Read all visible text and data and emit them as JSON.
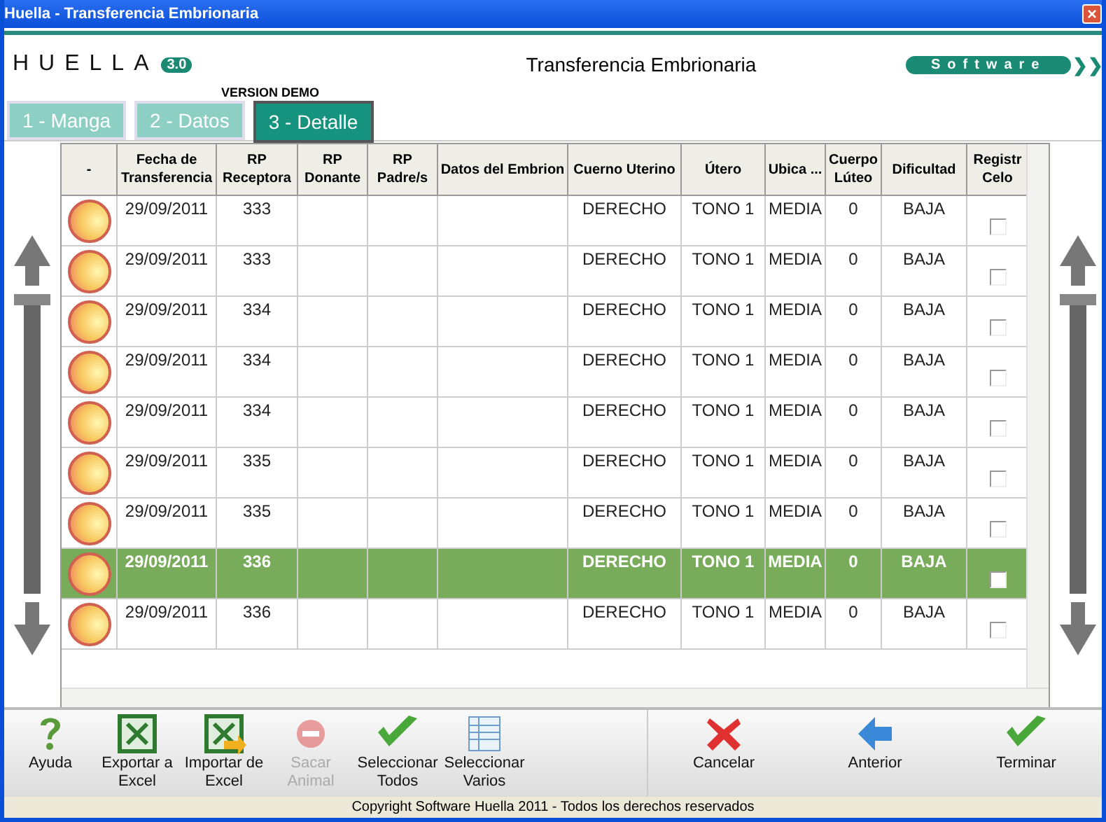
{
  "window": {
    "title": "Huella - Transferencia Embrionaria",
    "close": "×"
  },
  "header": {
    "logo": "HUELLA",
    "logo_version": "3.0",
    "title": "Transferencia Embrionaria",
    "badge": "Software",
    "badge_arrows": "❯❯"
  },
  "version_note": "VERSION DEMO",
  "tabs": [
    {
      "label": "1 - Manga",
      "selected": false
    },
    {
      "label": "2 - Datos",
      "selected": false
    },
    {
      "label": "3 - Detalle",
      "selected": true
    }
  ],
  "table": {
    "columns": [
      "-",
      "Fecha de Transferencia",
      "RP Receptora",
      "RP Donante",
      "RP Padre/s",
      "Datos del Embrion",
      "Cuerno Uterino",
      "Útero",
      "Ubica ...",
      "Cuerpo Lúteo",
      "Dificultad",
      "Registr Celo"
    ],
    "rows": [
      {
        "fecha": "29/09/2011",
        "rp_receptora": "333",
        "cuerno": "DERECHO",
        "utero": "TONO 1",
        "ubica": "MEDIA",
        "cuerpo": "0",
        "dificultad": "BAJA",
        "checked": false,
        "selected": false
      },
      {
        "fecha": "29/09/2011",
        "rp_receptora": "333",
        "cuerno": "DERECHO",
        "utero": "TONO 1",
        "ubica": "MEDIA",
        "cuerpo": "0",
        "dificultad": "BAJA",
        "checked": false,
        "selected": false
      },
      {
        "fecha": "29/09/2011",
        "rp_receptora": "334",
        "cuerno": "DERECHO",
        "utero": "TONO 1",
        "ubica": "MEDIA",
        "cuerpo": "0",
        "dificultad": "BAJA",
        "checked": false,
        "selected": false
      },
      {
        "fecha": "29/09/2011",
        "rp_receptora": "334",
        "cuerno": "DERECHO",
        "utero": "TONO 1",
        "ubica": "MEDIA",
        "cuerpo": "0",
        "dificultad": "BAJA",
        "checked": false,
        "selected": false
      },
      {
        "fecha": "29/09/2011",
        "rp_receptora": "334",
        "cuerno": "DERECHO",
        "utero": "TONO 1",
        "ubica": "MEDIA",
        "cuerpo": "0",
        "dificultad": "BAJA",
        "checked": false,
        "selected": false
      },
      {
        "fecha": "29/09/2011",
        "rp_receptora": "335",
        "cuerno": "DERECHO",
        "utero": "TONO 1",
        "ubica": "MEDIA",
        "cuerpo": "0",
        "dificultad": "BAJA",
        "checked": false,
        "selected": false
      },
      {
        "fecha": "29/09/2011",
        "rp_receptora": "335",
        "cuerno": "DERECHO",
        "utero": "TONO 1",
        "ubica": "MEDIA",
        "cuerpo": "0",
        "dificultad": "BAJA",
        "checked": false,
        "selected": false
      },
      {
        "fecha": "29/09/2011",
        "rp_receptora": "336",
        "cuerno": "DERECHO",
        "utero": "TONO 1",
        "ubica": "MEDIA",
        "cuerpo": "0",
        "dificultad": "BAJA",
        "checked": false,
        "selected": true
      },
      {
        "fecha": "29/09/2011",
        "rp_receptora": "336",
        "cuerno": "DERECHO",
        "utero": "TONO 1",
        "ubica": "MEDIA",
        "cuerpo": "0",
        "dificultad": "BAJA",
        "checked": false,
        "selected": false
      }
    ]
  },
  "toolbar": {
    "left": [
      {
        "label": "Ayuda",
        "kind": "help",
        "disabled": false
      },
      {
        "label": "Exportar a Excel",
        "kind": "export",
        "disabled": false
      },
      {
        "label": "Importar de Excel",
        "kind": "import",
        "disabled": false
      },
      {
        "label": "Sacar Animal",
        "kind": "remove",
        "disabled": true
      },
      {
        "label": "Seleccionar Todos",
        "kind": "checkall",
        "disabled": false
      },
      {
        "label": "Seleccionar Varios",
        "kind": "grid",
        "disabled": false
      }
    ],
    "right": [
      {
        "label": "Cancelar",
        "kind": "cancel",
        "disabled": false
      },
      {
        "label": "Anterior",
        "kind": "back",
        "disabled": false
      },
      {
        "label": "Terminar",
        "kind": "finish",
        "disabled": false
      }
    ]
  },
  "status_bar": "Copyright Software Huella 2011 - Todos los derechos reservados"
}
